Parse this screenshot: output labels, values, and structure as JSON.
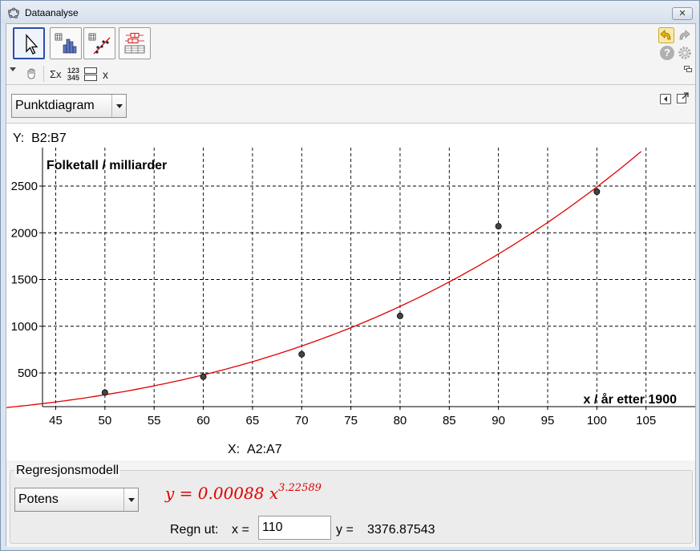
{
  "window": {
    "title": "Dataanalyse",
    "close_glyph": "✕"
  },
  "toolbar": {
    "tools": [
      "move-tool",
      "one-variable-stats-tool",
      "two-variable-regression-tool",
      "multi-variable-tool"
    ],
    "undo": "undo-icon",
    "redo": "redo-icon",
    "help": "?",
    "settings": "gear-icon"
  },
  "stylebar": {
    "sigma": "Σx",
    "numbers_top": "123",
    "numbers_bottom": "345",
    "x": "x"
  },
  "plot": {
    "type_select": "Punktdiagram",
    "y_source_prefix": "Y:",
    "y_source": "B2:B7",
    "x_source_prefix": "X:",
    "x_source": "A2:A7"
  },
  "chart_data": {
    "type": "scatter",
    "ylabel": "Folketall / milliarder",
    "xlabel": "x / år etter 1900",
    "xlim": [
      40,
      110
    ],
    "ylim": [
      380,
      2910
    ],
    "x_ticks": [
      45,
      50,
      55,
      60,
      65,
      70,
      75,
      80,
      85,
      90,
      95,
      100,
      105
    ],
    "y_ticks": [
      500,
      1000,
      1500,
      2000,
      2500
    ],
    "grid": true,
    "series": [
      {
        "x": [
          50,
          60,
          70,
          80,
          90,
          100
        ],
        "y": [
          290,
          460,
          700,
          1110,
          2070,
          2440
        ]
      }
    ],
    "regression_curve": {
      "coefficient": 0.00088,
      "exponent": 3.22589
    },
    "colors": {
      "points": "#444444",
      "curve": "#e00000",
      "grid": "#000000"
    }
  },
  "regression": {
    "group_label": "Regresjonsmodell",
    "model": "Potens",
    "equation_lhs": "y = 0.00088 x",
    "equation_exp": "3.22589",
    "compute_label": "Regn ut:",
    "x_label": "x =",
    "x_value": "110",
    "y_label": "y =",
    "y_value": "3376.87543"
  }
}
